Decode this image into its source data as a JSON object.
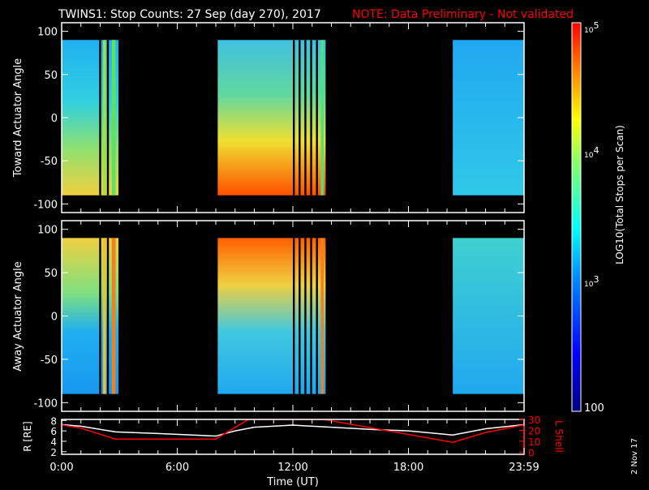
{
  "title": "TWINS1: Stop Counts: 27 Sep (day 270), 2017",
  "note": "NOTE: Data Preliminary - Not validated",
  "date_stamp": "2 Nov 17",
  "colors": {
    "note": "#ff0000",
    "lshell": "#ff0000",
    "r": "#ffffff"
  },
  "chart_data": [
    {
      "type": "heatmap",
      "name": "toward",
      "ylabel": "Toward Actuator Angle",
      "ylim": [
        -110,
        110
      ],
      "yticks": [
        "100",
        "50",
        "0",
        "-50",
        "-100"
      ],
      "ytick_values": [
        100,
        50,
        0,
        -50,
        -100
      ],
      "data_intervals_hours": [
        [
          0,
          2.95
        ],
        [
          8.1,
          13.7
        ],
        [
          20.3,
          24
        ]
      ],
      "gradient": "low at top (~1e3), high at bottom (~2e4-1e5)"
    },
    {
      "type": "heatmap",
      "name": "away",
      "ylabel": "Away Actuator Angle",
      "ylim": [
        -110,
        110
      ],
      "yticks": [
        "100",
        "50",
        "0",
        "-50",
        "-100"
      ],
      "ytick_values": [
        100,
        50,
        0,
        -50,
        -100
      ],
      "data_intervals_hours": [
        [
          0,
          2.95
        ],
        [
          8.1,
          13.7
        ],
        [
          20.3,
          24
        ]
      ],
      "gradient": "high at top (~2e4-1e5), low at bottom (~1e3)"
    },
    {
      "type": "line",
      "name": "orbit",
      "xlabel": "Time (UT)",
      "xticks": [
        "0:00",
        "6:00",
        "12:00",
        "18:00",
        "23:59"
      ],
      "xtick_values": [
        0,
        6,
        12,
        18,
        24
      ],
      "ylabel_left": "R [RE]",
      "yticks_left": [
        "8",
        "6",
        "4",
        "2"
      ],
      "ylim_left": [
        1.5,
        8.2
      ],
      "ylabel_right": "L Shell",
      "yticks_right": [
        "30",
        "20",
        "10",
        "0"
      ],
      "ylim_right": [
        -2,
        30
      ],
      "series": [
        {
          "name": "R",
          "axis": "left",
          "x": [
            0,
            1,
            2.8,
            5,
            8,
            9,
            10,
            12,
            14,
            16,
            18,
            20.3,
            22,
            24
          ],
          "y": [
            7.2,
            6.9,
            5.8,
            5.5,
            5.0,
            6.0,
            6.7,
            7.1,
            6.7,
            6.3,
            6.0,
            5.2,
            6.4,
            7.2
          ]
        },
        {
          "name": "L Shell",
          "axis": "right",
          "x": [
            0,
            1,
            2.8,
            8,
            9.7,
            13.6,
            20.3,
            22,
            24
          ],
          "y": [
            25,
            22,
            12,
            12,
            30,
            30,
            9,
            18,
            25
          ]
        }
      ]
    },
    {
      "type": "colorbar",
      "label": "LOG10(Total Stops per Scan)",
      "ticks": [
        "10^5",
        "10^4",
        "10^3",
        "100"
      ],
      "tick_values": [
        100000,
        10000,
        1000,
        100
      ]
    }
  ],
  "labels": {
    "cb_1e5": "10",
    "cb_1e5_exp": "5",
    "cb_1e4": "10",
    "cb_1e4_exp": "4",
    "cb_1e3": "10",
    "cb_1e3_exp": "3",
    "cb_100": "100"
  }
}
